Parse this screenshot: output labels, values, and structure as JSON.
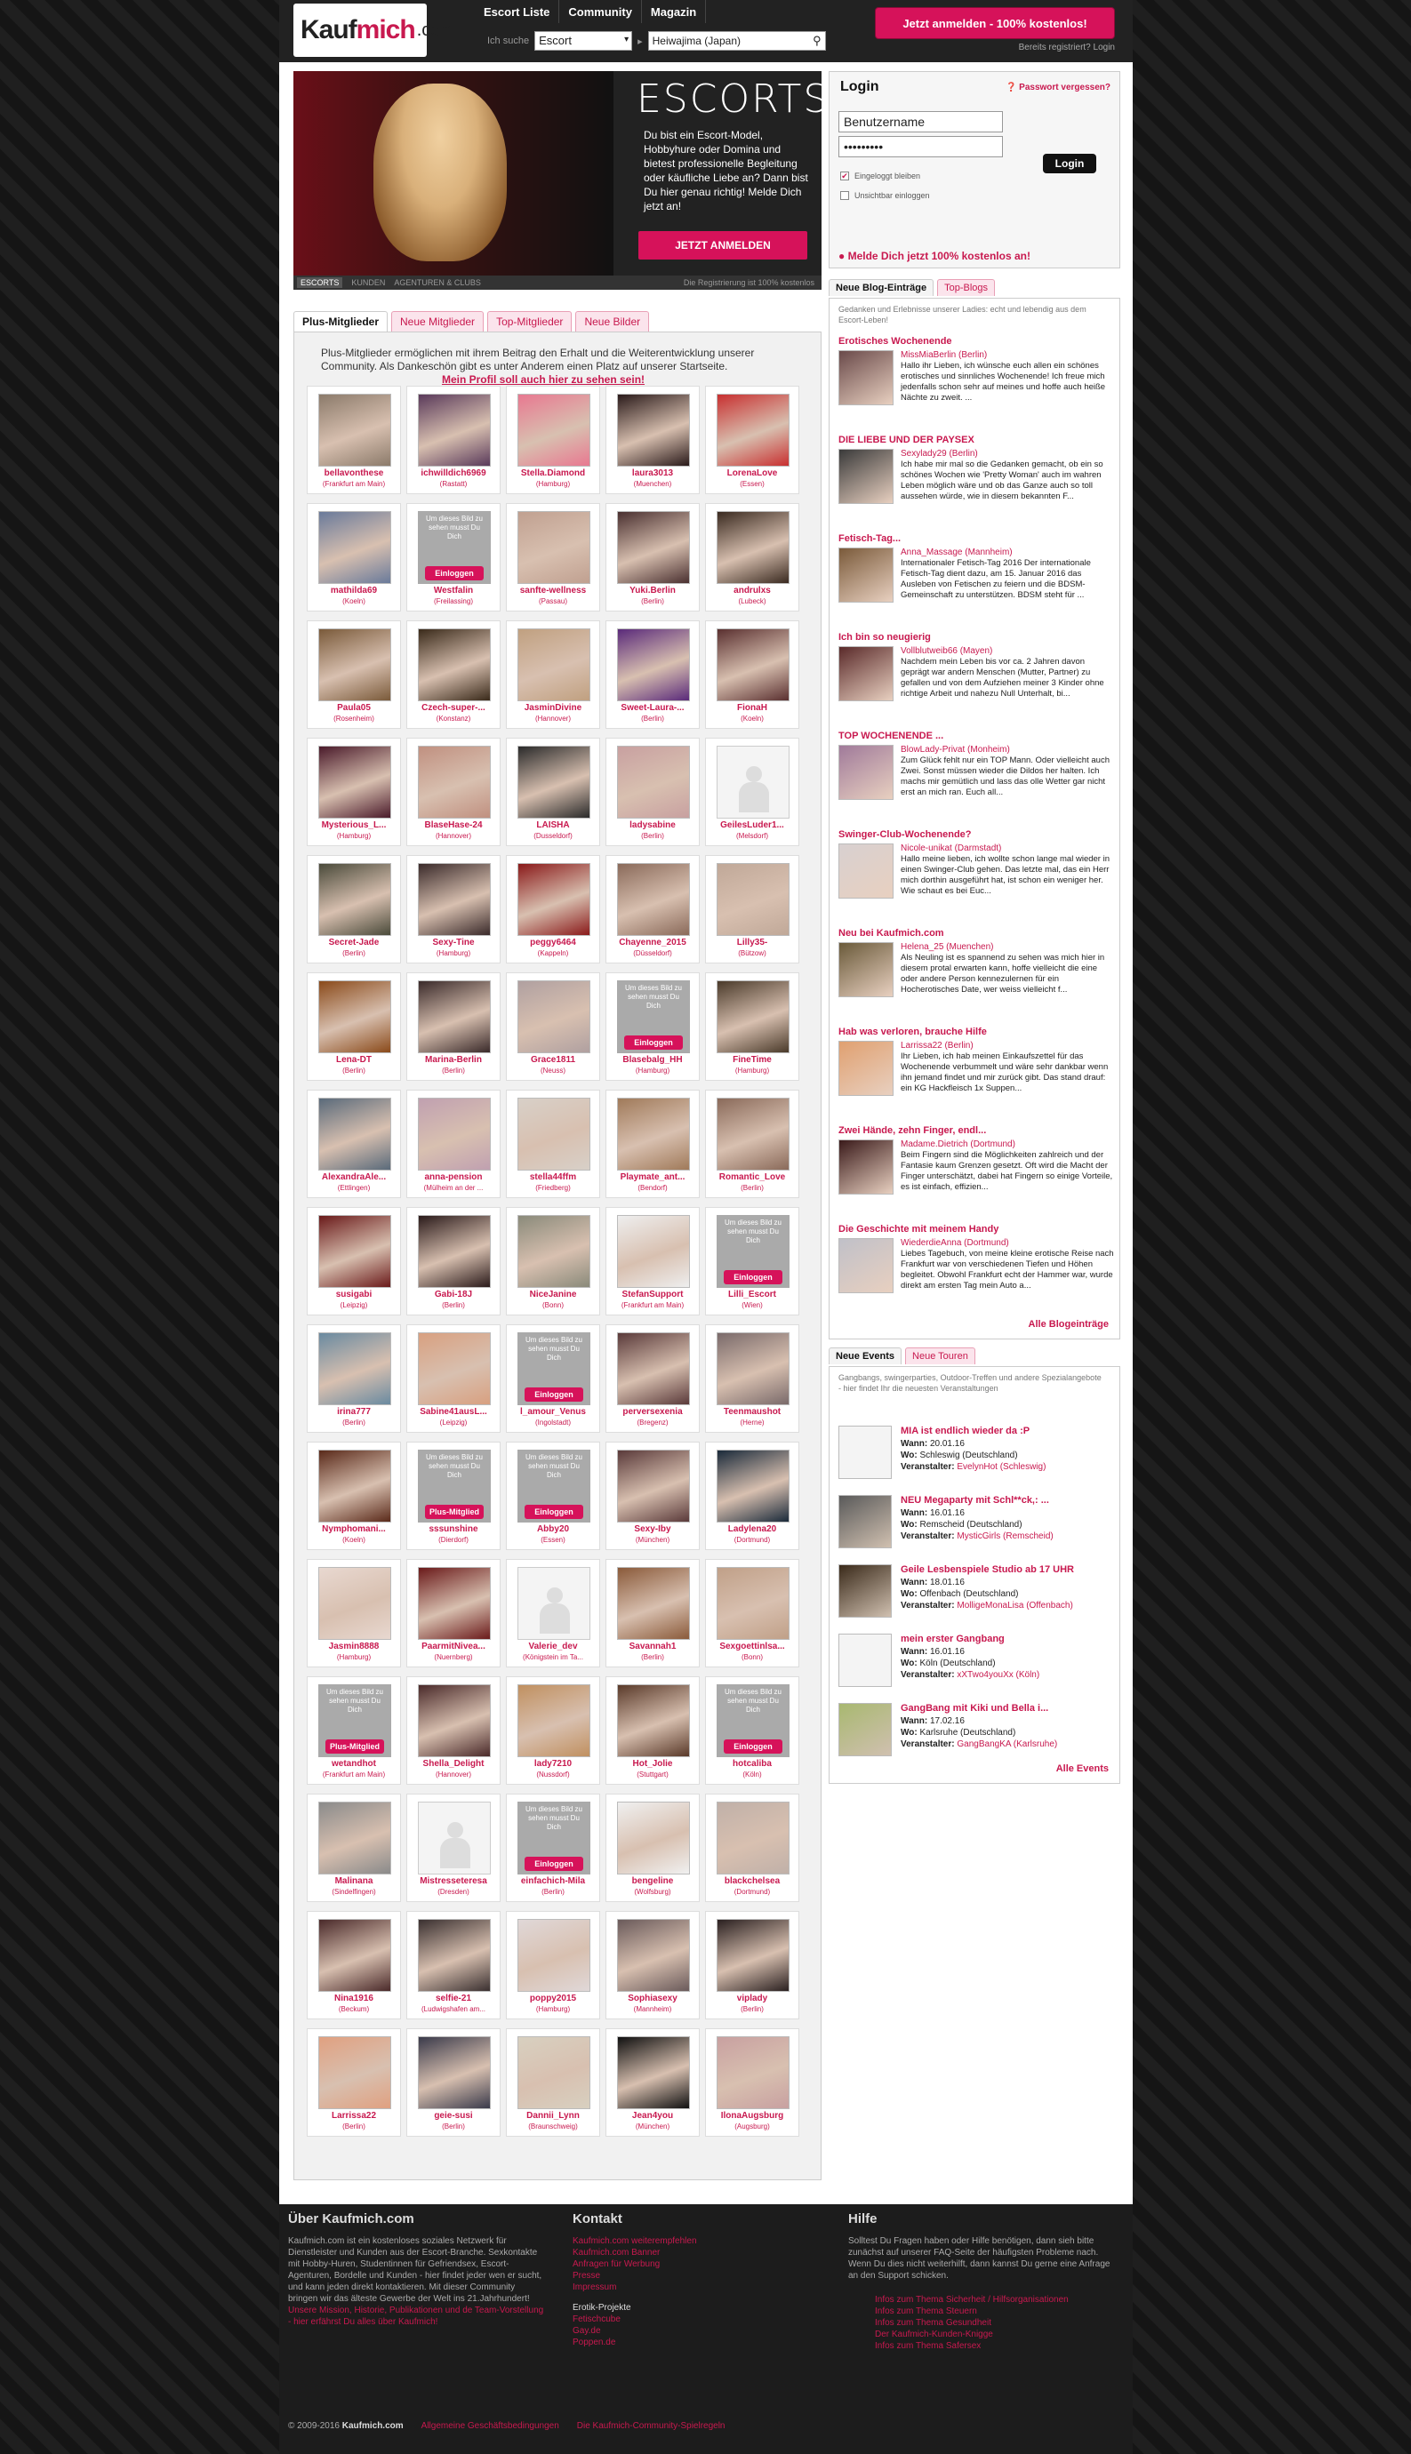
{
  "header": {
    "nav": [
      "Escort Liste",
      "Community",
      "Magazin"
    ],
    "search_label": "Ich suche",
    "search_select": "Escort",
    "location": "Heiwajima (Japan)",
    "register_btn": "Jetzt anmelden - 100% kostenlos!",
    "reg_links": "Bereits registriert?   Login"
  },
  "hero": {
    "title": "ESCORTS",
    "text": "Du bist ein Escort-Model, Hobbyhure oder Domina und bietest professionelle Begleitung oder käufliche Liebe an? Dann bist Du hier genau richtig! Melde Dich jetzt an!",
    "button": "JETZT ANMELDEN",
    "tabs": [
      "ESCORTS",
      "KUNDEN",
      "AGENTUREN & CLUBS"
    ],
    "note": "Die Registrierung ist 100% kostenlos"
  },
  "tabs": [
    "Plus-Mitglieder",
    "Neue Mitglieder",
    "Top-Mitglieder",
    "Neue Bilder"
  ],
  "plus_intro": "Plus-Mitglieder ermöglichen mit ihrem Beitrag den Erhalt und die Weiterentwicklung unserer Community. Als Dankeschön gibt es unter Anderem einen Platz auf unserer Startseite.",
  "plus_link": "Mein Profil soll auch hier zu sehen sein!",
  "members": [
    {
      "n": "bellavonthese",
      "c": "(Frankfurt am Main)",
      "col": "#8b7a6a"
    },
    {
      "n": "ichwilldich6969",
      "c": "(Rastatt)",
      "col": "#5a3a5a"
    },
    {
      "n": "Stella.Diamond",
      "c": "(Hamburg)",
      "col": "#e87890"
    },
    {
      "n": "laura3013",
      "c": "(Muenchen)",
      "col": "#2a1a1a"
    },
    {
      "n": "LorenaLove",
      "c": "(Essen)",
      "col": "#c83030"
    },
    {
      "n": "mathilda69",
      "c": "(Koeln)",
      "col": "#6a7a9a"
    },
    {
      "n": "Westfalin",
      "c": "(Freilassing)",
      "ov": "Einloggen"
    },
    {
      "n": "sanfte-wellness",
      "c": "(Passau)",
      "col": "#c0a090"
    },
    {
      "n": "Yuki.Berlin",
      "c": "(Berlin)",
      "col": "#4a3030"
    },
    {
      "n": "andrulxs",
      "c": "(Lubeck)",
      "col": "#3a2a20"
    },
    {
      "n": "Paula05",
      "c": "(Rosenheim)",
      "col": "#7a5a3a"
    },
    {
      "n": "Czech-super-...",
      "c": "(Konstanz)",
      "col": "#3a2a1a"
    },
    {
      "n": "JasminDivine",
      "c": "(Hannover)",
      "col": "#c0a080"
    },
    {
      "n": "Sweet-Laura-...",
      "c": "(Berlin)",
      "col": "#5a2a7a"
    },
    {
      "n": "FionaH",
      "c": "(Koeln)",
      "col": "#5a3030"
    },
    {
      "n": "Mysterious_L...",
      "c": "(Hamburg)",
      "col": "#4a1a2a"
    },
    {
      "n": "BlaseHase-24",
      "c": "(Hannover)",
      "col": "#c09080"
    },
    {
      "n": "LAISHA",
      "c": "(Dusseldorf)",
      "col": "#2a2a2a"
    },
    {
      "n": "ladysabine",
      "c": "(Berlin)",
      "col": "#c8a0a0"
    },
    {
      "n": "GeilesLuder1...",
      "c": "(Melsdorf)",
      "sil": true
    },
    {
      "n": "Secret-Jade",
      "c": "(Berlin)",
      "col": "#4a4a3a"
    },
    {
      "n": "Sexy-Tine",
      "c": "(Hamburg)",
      "col": "#3a2a2a"
    },
    {
      "n": "peggy6464",
      "c": "(Kappeln)",
      "col": "#8a1a1a"
    },
    {
      "n": "Chayenne_2015",
      "c": "(Düsseldorf)",
      "col": "#8a6a5a"
    },
    {
      "n": "Lilly35-",
      "c": "(Bützow)",
      "col": "#c0a898"
    },
    {
      "n": "Lena-DT",
      "c": "(Berlin)",
      "col": "#8a4a1a"
    },
    {
      "n": "Marina-Berlin",
      "c": "(Berlin)",
      "col": "#3a2a2a"
    },
    {
      "n": "Grace1811",
      "c": "(Neuss)",
      "col": "#b0a0a0"
    },
    {
      "n": "Blasebalg_HH",
      "c": "(Hamburg)",
      "ov": "Einloggen"
    },
    {
      "n": "FineTime",
      "c": "(Hamburg)",
      "col": "#4a3a2a"
    },
    {
      "n": "AlexandraAle...",
      "c": "(Ettlingen)",
      "col": "#5a6a7a"
    },
    {
      "n": "anna-pension",
      "c": "(Mülheim an der ...",
      "col": "#c0a0b0"
    },
    {
      "n": "stella44ffm",
      "c": "(Friedberg)",
      "col": "#d8d0c8"
    },
    {
      "n": "Playmate_ant...",
      "c": "(Bendorf)",
      "col": "#a07a5a"
    },
    {
      "n": "Romantic_Love",
      "c": "(Berlin)",
      "col": "#8a6a5a"
    },
    {
      "n": "susigabi",
      "c": "(Leipzig)",
      "col": "#6a1a1a"
    },
    {
      "n": "Gabi-18J",
      "c": "(Berlin)",
      "col": "#2a1a1a"
    },
    {
      "n": "NiceJanine",
      "c": "(Bonn)",
      "col": "#8a8a7a"
    },
    {
      "n": "StefanSupport",
      "c": "(Frankfurt am Main)",
      "col": "#eeeeee"
    },
    {
      "n": "Lilli_Escort",
      "c": "(Wien)",
      "ov": "Einloggen"
    },
    {
      "n": "irina777",
      "c": "(Berlin)",
      "col": "#6a8aa0"
    },
    {
      "n": "Sabine41ausL...",
      "c": "(Leipzig)",
      "col": "#d8a080"
    },
    {
      "n": "l_amour_Venus",
      "c": "(Ingolstadt)",
      "ov": "Einloggen"
    },
    {
      "n": "perversexenia",
      "c": "(Bregenz)",
      "col": "#5a3a3a"
    },
    {
      "n": "Teenmaushot",
      "c": "(Herne)",
      "col": "#7a6a6a"
    },
    {
      "n": "Nymphomani...",
      "c": "(Koeln)",
      "col": "#5a2a1a"
    },
    {
      "n": "sssunshine",
      "c": "(Dierdorf)",
      "ov": "Plus-Mitglied"
    },
    {
      "n": "Abby20",
      "c": "(Essen)",
      "ov": "Einloggen"
    },
    {
      "n": "Sexy-Iby",
      "c": "(München)",
      "col": "#5a3a3a"
    },
    {
      "n": "Ladylena20",
      "c": "(Dortmund)",
      "col": "#1a2a3a"
    },
    {
      "n": "Jasmin8888",
      "c": "(Hamburg)",
      "col": "#e8d8d0"
    },
    {
      "n": "PaarmitNivea...",
      "c": "(Nuernberg)",
      "col": "#6a1a1a"
    },
    {
      "n": "Valerie_dev",
      "c": "(Königstein im Ta...",
      "sil": true
    },
    {
      "n": "Savannah1",
      "c": "(Berlin)",
      "col": "#8a5a3a"
    },
    {
      "n": "Sexgoettinlsa...",
      "c": "(Bonn)",
      "col": "#c0a088"
    },
    {
      "n": "wetandhot",
      "c": "(Frankfurt am Main)",
      "ov": "Plus-Mitglied"
    },
    {
      "n": "Shella_Delight",
      "c": "(Hannover)",
      "col": "#4a2a2a"
    },
    {
      "n": "lady7210",
      "c": "(Nussdorf)",
      "col": "#c09060"
    },
    {
      "n": "Hot_Jolie",
      "c": "(Stuttgart)",
      "col": "#5a3a2a"
    },
    {
      "n": "hotcaliba",
      "c": "(Köln)",
      "ov": "Einloggen"
    },
    {
      "n": "Malinana",
      "c": "(Sindelfingen)",
      "col": "#8a8a8a"
    },
    {
      "n": "Mistresseteresa",
      "c": "(Dresden)",
      "sil": true
    },
    {
      "n": "einfachich-Mila",
      "c": "(Berlin)",
      "ov": "Einloggen"
    },
    {
      "n": "bengeline",
      "c": "(Wolfsburg)",
      "col": "#f0f0f0"
    },
    {
      "n": "blackchelsea",
      "c": "(Dortmund)",
      "col": "#c0b0a8"
    },
    {
      "n": "Nina1916",
      "c": "(Beckum)",
      "col": "#4a2a2a"
    },
    {
      "n": "selfie-21",
      "c": "(Ludwigshafen am...",
      "col": "#3a3030"
    },
    {
      "n": "poppy2015",
      "c": "(Hamburg)",
      "col": "#e0d8d8"
    },
    {
      "n": "Sophiasexy",
      "c": "(Mannheim)",
      "col": "#6a5a5a"
    },
    {
      "n": "viplady",
      "c": "(Berlin)",
      "col": "#2a2020"
    },
    {
      "n": "Larrissa22",
      "c": "(Berlin)",
      "col": "#e0a080"
    },
    {
      "n": "geie-susi",
      "c": "(Berlin)",
      "col": "#3a3a4a"
    },
    {
      "n": "Dannii_Lynn",
      "c": "(Braunschweig)",
      "col": "#d8d0c0"
    },
    {
      "n": "Jean4you",
      "c": "(München)",
      "col": "#101010"
    },
    {
      "n": "IlonaAugsburg",
      "c": "(Augsburg)",
      "col": "#c8a0a0"
    }
  ],
  "overlay_text": "Um dieses Bild zu sehen musst Du Dich",
  "login": {
    "title": "Login",
    "forgot": "Passwort vergessen?",
    "user_placeholder": "Benutzername",
    "pass": "•••••••••",
    "button": "Login",
    "remember": "Eingeloggt bleiben",
    "invisible": "Unsichtbar einloggen",
    "join": "Melde Dich jetzt 100% kostenlos an!"
  },
  "blog": {
    "tabs": [
      "Neue Blog-Einträge",
      "Top-Blogs"
    ],
    "intro": "Gedanken und Erlebnisse unserer Ladies: echt und lebendig aus dem Escort-Leben!",
    "more": "Alle Blogeinträge",
    "posts": [
      {
        "t": "Erotisches Wochenende",
        "a": "MissMiaBerlin (Berlin)",
        "x": "Hallo ihr Lieben, ich wünsche euch allen ein schönes erotisches und sinnliches Wochenende! Ich freue mich jedenfalls schon sehr auf meines und hoffe auch heiße Nächte zu zweit. ...",
        "col": "#6a4a4a"
      },
      {
        "t": "DIE LIEBE UND DER PAYSEX",
        "a": "Sexylady29 (Berlin)",
        "x": "Ich habe mir mal so die Gedanken gemacht, ob ein so schönes Wochen wie 'Pretty Woman' auch im wahren Leben möglich wäre und ob das Ganze auch so toll aussehen würde, wie in diesem bekannten F...",
        "col": "#3a3a3a"
      },
      {
        "t": "Fetisch-Tag...",
        "a": "Anna_Massage (Mannheim)",
        "x": "Internationaler Fetisch-Tag 2016 Der internationale Fetisch-Tag dient dazu, am 15. Januar 2016 das Ausleben von Fetischen zu feiern und die BDSM-Gemeinschaft zu unterstützen. BDSM steht für ...",
        "col": "#7a5a3a"
      },
      {
        "t": "Ich bin so neugierig",
        "a": "Vollblutweib66 (Mayen)",
        "x": "Nachdem mein Leben bis vor ca. 2 Jahren davon geprägt war andern Menschen (Mutter, Partner) zu gefallen und von dem Aufziehen meiner 3 Kinder ohne richtige Arbeit und nahezu Null Unterhalt, bi...",
        "col": "#5a2a2a"
      },
      {
        "t": "TOP WOCHENENDE ...",
        "a": "BlowLady-Privat (Monheim)",
        "x": "Zum Glück fehlt nur ein TOP Mann. Oder vielleicht auch Zwei. Sonst müssen wieder die Dildos her halten. Ich machs mir gemütlich und lass das olle Wetter gar nicht erst an mich ran. Euch all...",
        "col": "#a07a9a"
      },
      {
        "t": "Swinger-Club-Wochenende?",
        "a": "Nicole-unikat (Darmstadt)",
        "x": "Hallo meine lieben, ich wollte schon lange mal wieder in einen Swinger-Club gehen. Das letzte mal, das ein Herr mich dorthin ausgeführt hat, ist schon ein weniger her. Wie schaut es bei Euc...",
        "col": "#d8d0d0"
      },
      {
        "t": "Neu bei Kaufmich.com",
        "a": "Helena_25 (Muenchen)",
        "x": "Als Neuling ist es spannend zu sehen was mich hier in diesem protal erwarten kann, hoffe vielleicht die eine oder andere Person kennezulernen für ein Hocherotisches Date, wer weiss vielleicht f...",
        "col": "#6a5a3a"
      },
      {
        "t": "Hab was verloren, brauche Hilfe",
        "a": "Larrissa22 (Berlin)",
        "x": "Ihr Lieben, ich hab meinen Einkaufszettel für das Wochenende verbummelt und wäre sehr dankbar wenn ihn jemand findet und mir zurück gibt. Das stand drauf: ein KG Hackfleisch 1x Suppen...",
        "col": "#e0a070"
      },
      {
        "t": "Zwei Hände, zehn Finger, endl...",
        "a": "Madame.Dietrich (Dortmund)",
        "x": "Beim Fingern sind die Möglichkeiten zahlreich und der Fantasie kaum Grenzen gesetzt. Oft wird die Macht der Finger unterschätzt, dabei hat Fingern so einige Vorteile, es ist einfach, effizien...",
        "col": "#3a1a1a"
      },
      {
        "t": "Die Geschichte mit meinem Handy",
        "a": "WiederdieAnna (Dortmund)",
        "x": "Liebes Tagebuch, von meine kleine erotische Reise nach Frankfurt war von verschiedenen Tiefen und Höhen begleitet. Obwohl Frankfurt echt der Hammer war, wurde direkt am ersten Tag mein Auto a...",
        "col": "#c0c0c8"
      }
    ]
  },
  "events": {
    "tabs": [
      "Neue Events",
      "Neue Touren"
    ],
    "intro": "Gangbangs, swingerparties, Outdoor-Treffen und andere Spezialangebote - hier findet Ihr die neuesten Veranstaltungen",
    "more": "Alle Events",
    "lbl_when": "Wann:",
    "lbl_where": "Wo:",
    "lbl_org": "Veranstalter:",
    "items": [
      {
        "t": "MIA ist endlich wieder da :P",
        "w": "20.01.16",
        "o": "Schleswig (Deutschland)",
        "v": "EvelynHot (Schleswig)",
        "sil": true
      },
      {
        "t": "NEU Megaparty mit Schl**ck,: ...",
        "w": "16.01.16",
        "o": "Remscheid (Deutschland)",
        "v": "MysticGirls (Remscheid)",
        "col": "#5a5a5a"
      },
      {
        "t": "Geile Lesbenspiele Studio ab 17 UHR",
        "w": "18.01.16",
        "o": "Offenbach (Deutschland)",
        "v": "MolligeMonaLisa (Offenbach)",
        "col": "#3a2a1a"
      },
      {
        "t": "mein erster Gangbang",
        "w": "16.01.16",
        "o": "Köln (Deutschland)",
        "v": "xXTwo4youXx (Köln)",
        "sil": true
      },
      {
        "t": "GangBang mit Kiki und Bella i...",
        "w": "17.02.16",
        "o": "Karlsruhe (Deutschland)",
        "v": "GangBangKA (Karlsruhe)",
        "col": "#a8b870"
      }
    ]
  },
  "footer": {
    "about_title": "Über Kaufmich.com",
    "about_text": "Kaufmich.com ist ein kostenloses soziales Netzwerk für Dienstleister und Kunden aus der Escort-Branche. Sexkontakte mit Hobby-Huren, Studentinnen für Gefriendsex, Escort-Agenturen, Bordelle und Kunden - hier findet jeder wen er sucht, und kann jeden direkt kontaktieren. Mit dieser Community bringen wir das älteste Gewerbe der Welt ins 21.Jahrhundert!",
    "about_link": "Unsere Mission, Historie, Publikationen und de Team-Vorstellung - hier erfährst Du alles über Kaufmich!",
    "contact_title": "Kontakt",
    "contact_links": [
      "Kaufmich.com weiterempfehlen",
      "Kaufmich.com Banner",
      "Anfragen für Werbung",
      "Presse",
      "Impressum"
    ],
    "erotik_title": "Erotik-Projekte",
    "erotik_links": [
      "Fetischcube",
      "Gay.de",
      "Poppen.de"
    ],
    "help_title": "Hilfe",
    "help_text": "Solltest Du Fragen haben oder Hilfe benötigen, dann sieh bitte zunächst auf unserer FAQ-Seite der häufigsten Probleme nach. Wenn Du dies nicht weiterhilft, dann kannst Du gerne eine Anfrage an den Support schicken.",
    "help_links": [
      "Infos zum Thema Sicherheit / Hilfsorganisationen",
      "Infos zum Thema Steuern",
      "Infos zum Thema Gesundheit",
      "Der Kaufmich-Kunden-Knigge",
      "Infos zum Thema Safersex"
    ],
    "copyright": "© 2009-2016",
    "brand": "Kaufmich.com",
    "agb": "Allgemeine Geschäftsbedingungen",
    "rules": "Die Kaufmich-Community-Spielregeln"
  }
}
